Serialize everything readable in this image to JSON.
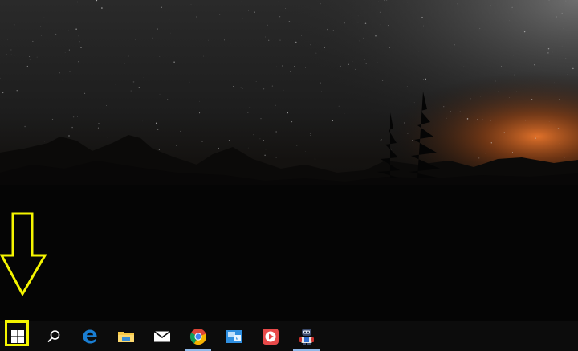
{
  "desktop": {
    "wallpaper": "night-mountain-forest-silhouette"
  },
  "taskbar": {
    "items": [
      {
        "icon": "windows-start-icon"
      },
      {
        "icon": "search-icon"
      },
      {
        "icon": "edge-browser-icon",
        "active": false
      },
      {
        "icon": "file-explorer-icon",
        "active": false
      },
      {
        "icon": "mail-icon",
        "active": false
      },
      {
        "icon": "chrome-browser-icon",
        "active": true
      },
      {
        "icon": "remote-desktop-icon",
        "active": false
      },
      {
        "icon": "media-player-icon",
        "active": false
      },
      {
        "icon": "assistant-robot-icon",
        "active": true
      }
    ]
  },
  "annotation": {
    "color": "#f5f500",
    "target": "windows-start-icon"
  },
  "colors": {
    "taskbar": "#0c0c0c",
    "accent": "#8fb8e8",
    "edge": "#1a7fd4",
    "chrome_red": "#db4437",
    "chrome_green": "#0f9d58",
    "chrome_yellow": "#f4b400",
    "chrome_blue": "#4285f4",
    "folder": "#f7c948"
  }
}
